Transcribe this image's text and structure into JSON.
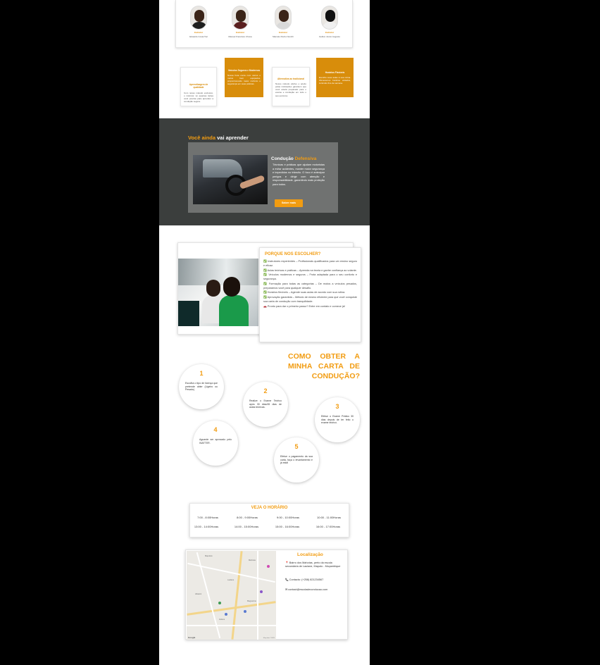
{
  "colors": {
    "accent": "#f29c11",
    "accent_dark": "#d88d0b",
    "dark_section": "#3b3e3d",
    "card_gray": "#707271",
    "check_green": "#22a33a"
  },
  "instructors": [
    {
      "role": "Instrutor",
      "name": "Eduardo Costa Tiel"
    },
    {
      "role": "Instrutor",
      "name": "Manuel Francisco Chuva"
    },
    {
      "role": "Instrutor",
      "name": "Marcelo Pedro Nonchi"
    },
    {
      "role": "Instrutor",
      "name": "Ueliton Junior Augusto"
    }
  ],
  "features": [
    {
      "title": "Aprendizagem de qualidade",
      "desc": "Com nosso método exclusivo, o instrutor vê quantas lições você precisa para aprender a condução segura."
    },
    {
      "title": "Veículos Seguros e Modernos",
      "desc": "Nossa frota conta com carros e motos bem equipados, proporcionando maior conforto e segurança em suas práticas."
    },
    {
      "title": "Alternativa ao tradicional",
      "desc": "Nosso método efetivo e aceito pelas instituições garantem que você estará preparado para o exame e condução em todo o seu percurso."
    },
    {
      "title": "Horários Flexíveis",
      "desc": "Escolha suas aulas à sua rotina. Oferecemos horários variados, incluindo fins de semana."
    }
  ],
  "learn": {
    "title_accent": "Você ainda",
    "title_rest": " vai aprender",
    "card_title_plain": "Condução ",
    "card_title_accent": "Defensiva",
    "card_desc": "Técnicas e práticas que ajudam motoristas a evitar acidentes, manter maior segurança e impedidos no trânsito. O foco é antecipar perigos e dirigir com atenção e responsabilidade, garantindo mais proteção para todos.",
    "button": "Saber mais"
  },
  "why": {
    "title": "PORQUE NOS ESCOLHER?",
    "items": [
      "✅ Instrutores experientes – Profissionais qualificados para um ensino seguro e eficaz.",
      "✅ Aulas teóricas e práticas – Aprenda na teoria e ganhe confiança ao volante.",
      "✅ Veículos modernos e seguros – Frota adaptada para o seu conforto e segurança.",
      "✅ Formação para todas as categorias – De motos a veículos pesados, preparamos você para qualquer desafio.",
      "✅ Horários flexíveis – Agende suas aulas de acordo com sua rotina.",
      "✅ Aprovação garantida – Método de ensino eficiente para que você conquiste sua carta de condução com tranquilidade.",
      "🚗 Pronto para dar o primeiro passo? Entre em contato e comece já!"
    ]
  },
  "steps": {
    "title": "COMO OBTER A MINHA CARTA DE CONDUÇÃO?",
    "items": [
      {
        "n": "1",
        "text": "Escolha o tipo de licença que pretende obter (Ligeiro ou Pesado)"
      },
      {
        "n": "2",
        "text": "Realize o Exame Teórico após 30 dias/45 dias de aulas teóricas."
      },
      {
        "n": "3",
        "text": "Efetue o Exame Prático 30 dias depois de ter feito o exame teórico."
      },
      {
        "n": "4",
        "text": "Aguarde ser aprovado pelo INATTER."
      },
      {
        "n": "5",
        "text": "Efetue o pagamento da sua carta, faça o levantamento e já está!"
      }
    ]
  },
  "schedule": {
    "title": "VEJA O HORÁRIO",
    "slots": [
      "7:00 - 8:00Horas",
      "8:00 - 9:00Horas",
      "9:00 - 10:00Horas",
      "10:00 - 11:00Horas",
      "13:00 - 14:00Horas",
      "14:00 - 15:00Horas",
      "15:00 - 16:00Horas",
      "16:00 - 17:00Horas"
    ]
  },
  "location": {
    "title": "Localização",
    "address": "📍 Bairro dos Mahotas, perto da escola secundária de Laulane, Maputo - Moçambique",
    "contact": "📞 Contacto: (+258) 821234567",
    "email": "✉ contact@escoladeconducao.com",
    "map_labels": [
      "Mapuluto",
      "Mahotas",
      "Laulane",
      "Albasini",
      "Magoanine",
      "Hulene"
    ],
    "map_google": "Google",
    "map_copyright": "Map data ©2025"
  }
}
